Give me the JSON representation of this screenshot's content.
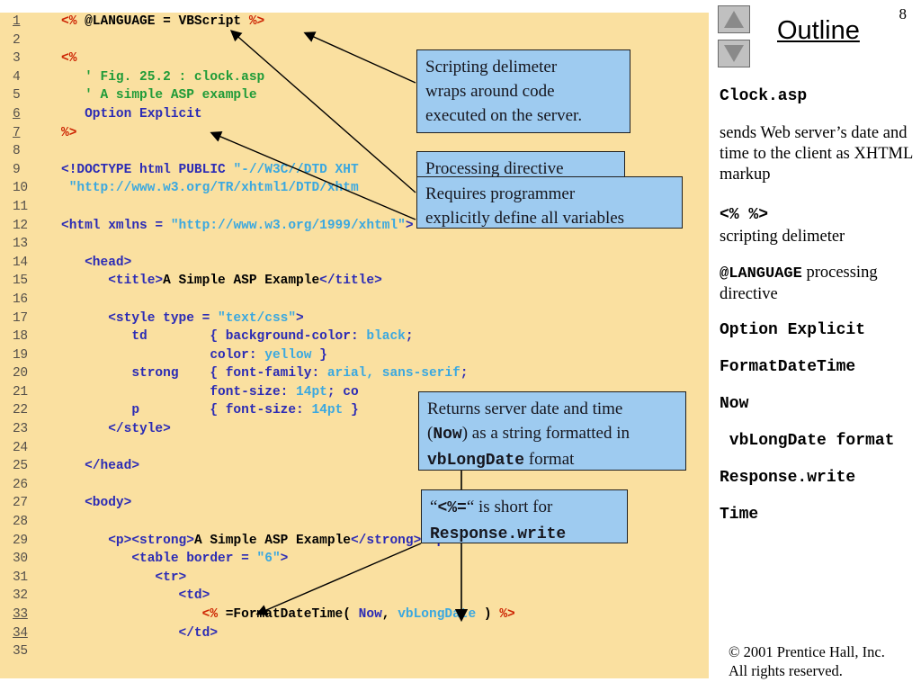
{
  "slide": {
    "page_number": "8",
    "outline_title": "Outline",
    "nav": {
      "up_label": "previous-slide",
      "down_label": "next-slide"
    }
  },
  "code": {
    "lines": [
      {
        "n": "1",
        "underline": true,
        "indent": 0,
        "tokens": [
          {
            "t": "<% ",
            "c": "red"
          },
          {
            "t": "@LANGUAGE = VBScript ",
            "c": "black"
          },
          {
            "t": "%>",
            "c": "red"
          }
        ]
      },
      {
        "n": "2",
        "underline": false,
        "indent": 0,
        "tokens": []
      },
      {
        "n": "3",
        "underline": false,
        "indent": 0,
        "tokens": [
          {
            "t": "<%",
            "c": "red"
          }
        ]
      },
      {
        "n": "4",
        "underline": false,
        "indent": 0,
        "tokens": [
          {
            "t": "   ' Fig. 25.2 : clock.asp",
            "c": "green"
          }
        ]
      },
      {
        "n": "5",
        "underline": false,
        "indent": 0,
        "tokens": [
          {
            "t": "   ' A simple ASP example",
            "c": "green"
          }
        ]
      },
      {
        "n": "6",
        "underline": true,
        "indent": 0,
        "tokens": [
          {
            "t": "   ",
            "c": "black"
          },
          {
            "t": "Option Explicit",
            "c": "navy"
          }
        ]
      },
      {
        "n": "7",
        "underline": true,
        "indent": 0,
        "tokens": [
          {
            "t": "%>",
            "c": "red"
          }
        ]
      },
      {
        "n": "8",
        "underline": false,
        "indent": 0,
        "tokens": []
      },
      {
        "n": "9",
        "underline": false,
        "indent": 0,
        "tokens": [
          {
            "t": "<!DOCTYPE html PUBLIC ",
            "c": "navy"
          },
          {
            "t": "\"-//W3C//DTD XHT",
            "c": "cyan"
          }
        ]
      },
      {
        "n": "10",
        "underline": false,
        "indent": 0,
        "tokens": [
          {
            "t": " \"http://www.w3.org/TR/xhtml1/DTD/xhtm",
            "c": "cyan"
          }
        ]
      },
      {
        "n": "11",
        "underline": false,
        "indent": 0,
        "tokens": []
      },
      {
        "n": "12",
        "underline": false,
        "indent": 0,
        "tokens": [
          {
            "t": "<html xmlns = ",
            "c": "navy"
          },
          {
            "t": "\"http://www.w3.org/1999/xhtml\"",
            "c": "cyan"
          },
          {
            "t": ">",
            "c": "navy"
          }
        ]
      },
      {
        "n": "13",
        "underline": false,
        "indent": 0,
        "tokens": []
      },
      {
        "n": "14",
        "underline": false,
        "indent": 0,
        "tokens": [
          {
            "t": "   <head>",
            "c": "navy"
          }
        ]
      },
      {
        "n": "15",
        "underline": false,
        "indent": 0,
        "tokens": [
          {
            "t": "      <title>",
            "c": "navy"
          },
          {
            "t": "A Simple ASP Example",
            "c": "black"
          },
          {
            "t": "</title>",
            "c": "navy"
          }
        ]
      },
      {
        "n": "16",
        "underline": false,
        "indent": 0,
        "tokens": []
      },
      {
        "n": "17",
        "underline": false,
        "indent": 0,
        "tokens": [
          {
            "t": "      <style type = ",
            "c": "navy"
          },
          {
            "t": "\"text/css\"",
            "c": "cyan"
          },
          {
            "t": ">",
            "c": "navy"
          }
        ]
      },
      {
        "n": "18",
        "underline": false,
        "indent": 0,
        "tokens": [
          {
            "t": "         td        { background-color: ",
            "c": "navy"
          },
          {
            "t": "black",
            "c": "cyan"
          },
          {
            "t": ";",
            "c": "navy"
          }
        ]
      },
      {
        "n": "19",
        "underline": false,
        "indent": 0,
        "tokens": [
          {
            "t": "                   color: ",
            "c": "navy"
          },
          {
            "t": "yellow",
            "c": "cyan"
          },
          {
            "t": " }",
            "c": "navy"
          }
        ]
      },
      {
        "n": "20",
        "underline": false,
        "indent": 0,
        "tokens": [
          {
            "t": "         strong    { font-family: ",
            "c": "navy"
          },
          {
            "t": "arial, sans-serif",
            "c": "cyan"
          },
          {
            "t": ";",
            "c": "navy"
          }
        ]
      },
      {
        "n": "21",
        "underline": false,
        "indent": 0,
        "tokens": [
          {
            "t": "                   font-size: ",
            "c": "navy"
          },
          {
            "t": "14pt",
            "c": "cyan"
          },
          {
            "t": "; co",
            "c": "navy"
          }
        ]
      },
      {
        "n": "22",
        "underline": false,
        "indent": 0,
        "tokens": [
          {
            "t": "         p         { font-size: ",
            "c": "navy"
          },
          {
            "t": "14pt",
            "c": "cyan"
          },
          {
            "t": " }",
            "c": "navy"
          }
        ]
      },
      {
        "n": "23",
        "underline": false,
        "indent": 0,
        "tokens": [
          {
            "t": "      </style>",
            "c": "navy"
          }
        ]
      },
      {
        "n": "24",
        "underline": false,
        "indent": 0,
        "tokens": []
      },
      {
        "n": "25",
        "underline": false,
        "indent": 0,
        "tokens": [
          {
            "t": "   </head>",
            "c": "navy"
          }
        ]
      },
      {
        "n": "26",
        "underline": false,
        "indent": 0,
        "tokens": []
      },
      {
        "n": "27",
        "underline": false,
        "indent": 0,
        "tokens": [
          {
            "t": "   <body>",
            "c": "navy"
          }
        ]
      },
      {
        "n": "28",
        "underline": false,
        "indent": 0,
        "tokens": []
      },
      {
        "n": "29",
        "underline": false,
        "indent": 0,
        "tokens": [
          {
            "t": "      <p><strong>",
            "c": "navy"
          },
          {
            "t": "A Simple ASP Example",
            "c": "black"
          },
          {
            "t": "</strong></p>",
            "c": "navy"
          }
        ]
      },
      {
        "n": "30",
        "underline": false,
        "indent": 0,
        "tokens": [
          {
            "t": "         <table border = ",
            "c": "navy"
          },
          {
            "t": "\"6\"",
            "c": "cyan"
          },
          {
            "t": ">",
            "c": "navy"
          }
        ]
      },
      {
        "n": "31",
        "underline": false,
        "indent": 0,
        "tokens": [
          {
            "t": "            <tr>",
            "c": "navy"
          }
        ]
      },
      {
        "n": "32",
        "underline": false,
        "indent": 0,
        "tokens": [
          {
            "t": "               <td>",
            "c": "navy"
          }
        ]
      },
      {
        "n": "33",
        "underline": true,
        "indent": 0,
        "tokens": [
          {
            "t": "                  <% ",
            "c": "red"
          },
          {
            "t": "=FormatDateTime( ",
            "c": "black"
          },
          {
            "t": "Now",
            "c": "navy"
          },
          {
            "t": ", ",
            "c": "black"
          },
          {
            "t": "vbLongDate",
            "c": "cyan"
          },
          {
            "t": " ) ",
            "c": "black"
          },
          {
            "t": "%>",
            "c": "red"
          }
        ]
      },
      {
        "n": "34",
        "underline": true,
        "indent": 0,
        "tokens": [
          {
            "t": "               </td>",
            "c": "navy"
          }
        ]
      },
      {
        "n": "35",
        "underline": false,
        "indent": 0,
        "tokens": []
      }
    ]
  },
  "callouts": [
    {
      "id": "scripting-delimiter",
      "html": "Scripting delimeter<br>wraps around code<br>executed on the server."
    },
    {
      "id": "processing-directive",
      "html": "Processing directive"
    },
    {
      "id": "option-explicit",
      "html": "Requires programmer<br>explicitly define all variables"
    },
    {
      "id": "format-date-time",
      "html": "Returns server date and time<br>(<span class=\"mono\">Now</span>) as a string formatted in<br><span class=\"mono\">vbLongDate</span> format"
    },
    {
      "id": "response-write",
      "html": "&#8220;<span class=\"mono\">&lt;%=</span>&#8220; is short for<br><span class=\"mono\">Response.write</span>"
    }
  ],
  "outline": {
    "heading": "Clock.asp",
    "description": "sends Web server’s date and time to the client as XHTML markup",
    "entries": [
      {
        "mono": "<% %>",
        "serif": "scripting delimeter"
      },
      {
        "mono_inline": "@LANGUAGE",
        "serif_inline": " processing directive"
      },
      {
        "mono": "Option Explicit"
      },
      {
        "mono": "FormatDateTime"
      },
      {
        "mono": "Now"
      },
      {
        "mono": " vbLongDate format"
      },
      {
        "mono": "Response.write"
      },
      {
        "mono": "Time"
      }
    ],
    "footer_line1": "© 2001 Prentice Hall, Inc.",
    "footer_line2": "All rights reserved."
  },
  "colors": {
    "code_background": "#fae0a0",
    "callout_background": "#9ecbf0",
    "keyword_red": "#cc2200",
    "comment_green": "#1f9b38",
    "tag_navy": "#2b2bb5",
    "string_cyan": "#3aa8e0"
  }
}
